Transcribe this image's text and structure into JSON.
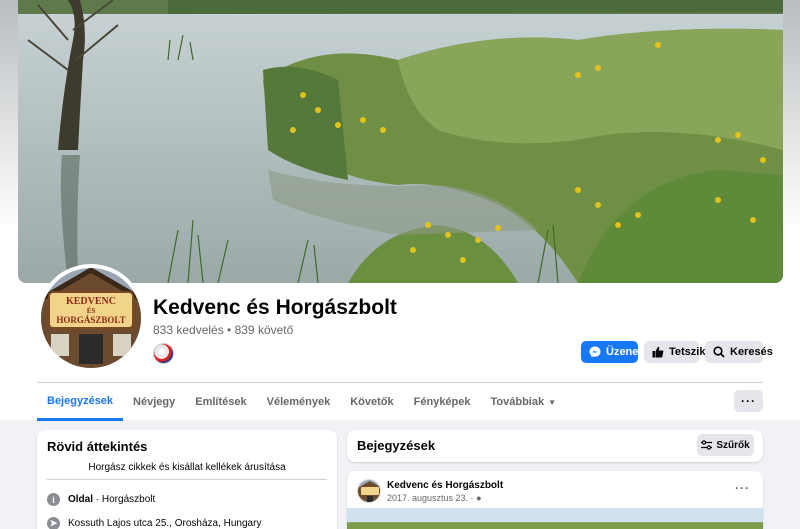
{
  "page": {
    "title": "Kedvenc és Horgászbolt",
    "stats": "833 kedvelés • 839 követő",
    "logo_text_line1": "KEDVENC",
    "logo_text_line2": "ÉS",
    "logo_text_line3": "HORGÁSZBOLT"
  },
  "actions": {
    "message": "Üzenet",
    "like": "Tetszik",
    "search": "Keresés"
  },
  "tabs": [
    {
      "label": "Bejegyzések",
      "active": true
    },
    {
      "label": "Névjegy"
    },
    {
      "label": "Említések"
    },
    {
      "label": "Vélemények"
    },
    {
      "label": "Követők"
    },
    {
      "label": "Fényképek"
    },
    {
      "label": "Továbbiak"
    }
  ],
  "more_button": "···",
  "intro": {
    "title": "Rövid áttekintés",
    "description": "Horgász cikkek és kisállat kellékek árusítása",
    "category_label": "Oldal",
    "category_value": " · Horgászbolt",
    "address": "Kossuth Lajos utca 25., Orosháza, Hungary"
  },
  "posts_section": {
    "title": "Bejegyzések",
    "filter": "Szűrők"
  },
  "post": {
    "author": "Kedvenc és Horgászbolt",
    "date": "2017. augusztus 23. · ",
    "menu": "···"
  },
  "colors": {
    "accent": "#1877f2",
    "secondary_button": "#e4e6eb",
    "background": "#f0f2f5"
  }
}
